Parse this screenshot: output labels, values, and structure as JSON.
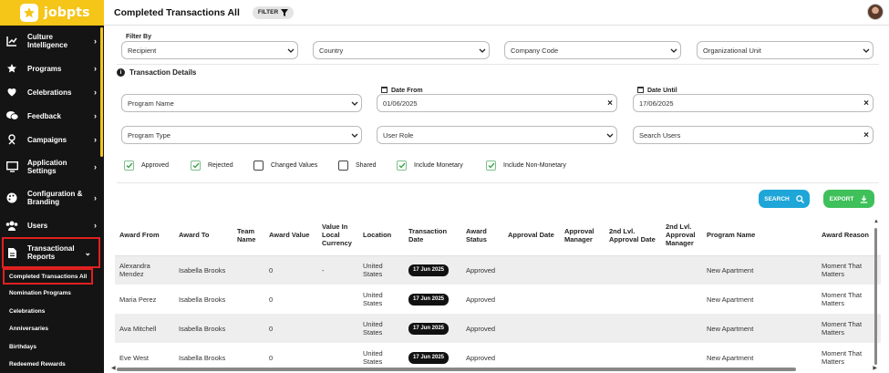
{
  "app": {
    "logo_text": "jobpts"
  },
  "header": {
    "title": "Completed Transactions All",
    "filter_label": "FILTER"
  },
  "sidebar": {
    "items": [
      {
        "label": "Culture Intelligence",
        "icon": "chart-icon"
      },
      {
        "label": "Programs",
        "icon": "star-icon"
      },
      {
        "label": "Celebrations",
        "icon": "heart-icon"
      },
      {
        "label": "Feedback",
        "icon": "chat-icon"
      },
      {
        "label": "Campaigns",
        "icon": "campaign-icon"
      },
      {
        "label": "Application Settings",
        "icon": "monitor-icon"
      },
      {
        "label": "Configuration & Branding",
        "icon": "palette-icon"
      },
      {
        "label": "Users",
        "icon": "users-icon"
      },
      {
        "label": "Transactional Reports",
        "icon": "report-icon"
      }
    ],
    "sub_items": [
      "Completed Transactions All",
      "Nomination Programs",
      "Celebrations",
      "Anniversaries",
      "Birthdays",
      "Redeemed Rewards"
    ]
  },
  "filters": {
    "filter_by_label": "Filter By",
    "filter_by_value": "Recipient",
    "country_placeholder": "Country",
    "company_code_placeholder": "Company Code",
    "org_unit_placeholder": "Organizational Unit",
    "section_title": "Transaction Details",
    "program_name_placeholder": "Program Name",
    "date_from_label": "Date From",
    "date_from_value": "01/06/2025",
    "date_until_label": "Date Until",
    "date_until_value": "17/06/2025",
    "program_type_placeholder": "Program Type",
    "user_role_placeholder": "User Role",
    "search_users_placeholder": "Search Users"
  },
  "checkboxes": [
    {
      "label": "Approved",
      "checked": true
    },
    {
      "label": "Rejected",
      "checked": true
    },
    {
      "label": "Changed Values",
      "checked": false
    },
    {
      "label": "Shared",
      "checked": false
    },
    {
      "label": "Include Monetary",
      "checked": true
    },
    {
      "label": "Include Non-Monetary",
      "checked": true
    }
  ],
  "buttons": {
    "search": "SEARCH",
    "export": "EXPORT"
  },
  "table": {
    "columns": [
      "Award From",
      "Award To",
      "Team Name",
      "Award Value",
      "Value In Local Currency",
      "Location",
      "Transaction Date",
      "Award Status",
      "Approval Date",
      "Approval Manager",
      "2nd Lvl. Approval Date",
      "2nd Lvl. Approval Manager",
      "Program Name",
      "Award Reason"
    ],
    "rows": [
      [
        "Alexandra Mendez",
        "Isabella Brooks",
        "",
        "0",
        "-",
        "United States",
        "17 Jun 2025",
        "Approved",
        "",
        "",
        "",
        "",
        "New Apartment",
        "Moment That Matters"
      ],
      [
        "Maria Perez",
        "Isabella Brooks",
        "",
        "0",
        "",
        "United States",
        "17 Jun 2025",
        "Approved",
        "",
        "",
        "",
        "",
        "New Apartment",
        "Moment That Matters"
      ],
      [
        "Ava Mitchell",
        "Isabella Brooks",
        "",
        "0",
        "",
        "United States",
        "17 Jun 2025",
        "Approved",
        "",
        "",
        "",
        "",
        "New Apartment",
        "Moment That Matters"
      ],
      [
        "Eve West",
        "Isabella Brooks",
        "",
        "0",
        "",
        "United States",
        "17 Jun 2025",
        "Approved",
        "",
        "",
        "",
        "",
        "New Apartment",
        "Moment That Matters"
      ]
    ]
  }
}
